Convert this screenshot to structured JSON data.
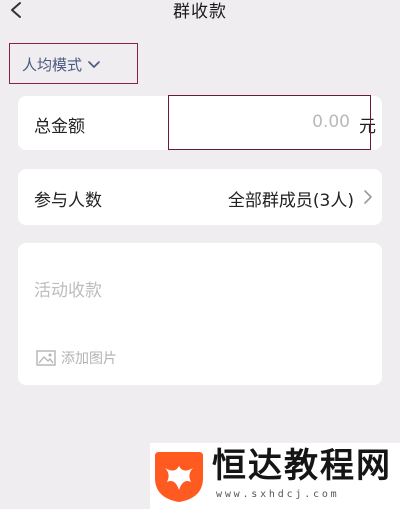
{
  "header": {
    "title": "群收款",
    "back_icon": "chevron-left-icon"
  },
  "mode": {
    "label": "人均模式",
    "icon": "chevron-down-icon"
  },
  "amount": {
    "label": "总金额",
    "placeholder": "0.00",
    "unit": "元"
  },
  "members": {
    "label": "参与人数",
    "value": "全部群成员(3人)",
    "icon": "chevron-right-icon"
  },
  "description": {
    "placeholder": "活动收款",
    "add_image_label": "添加图片",
    "add_image_icon": "image-icon"
  },
  "watermark": {
    "text": "恒达教程网",
    "url": "www.sxhdcj.com",
    "logo_color": "#ff5a1f"
  },
  "colors": {
    "background": "#efedf0",
    "card": "#ffffff",
    "mode_text": "#4a5a80",
    "placeholder": "#b9b9b9",
    "highlight_border": "#8a2244"
  }
}
